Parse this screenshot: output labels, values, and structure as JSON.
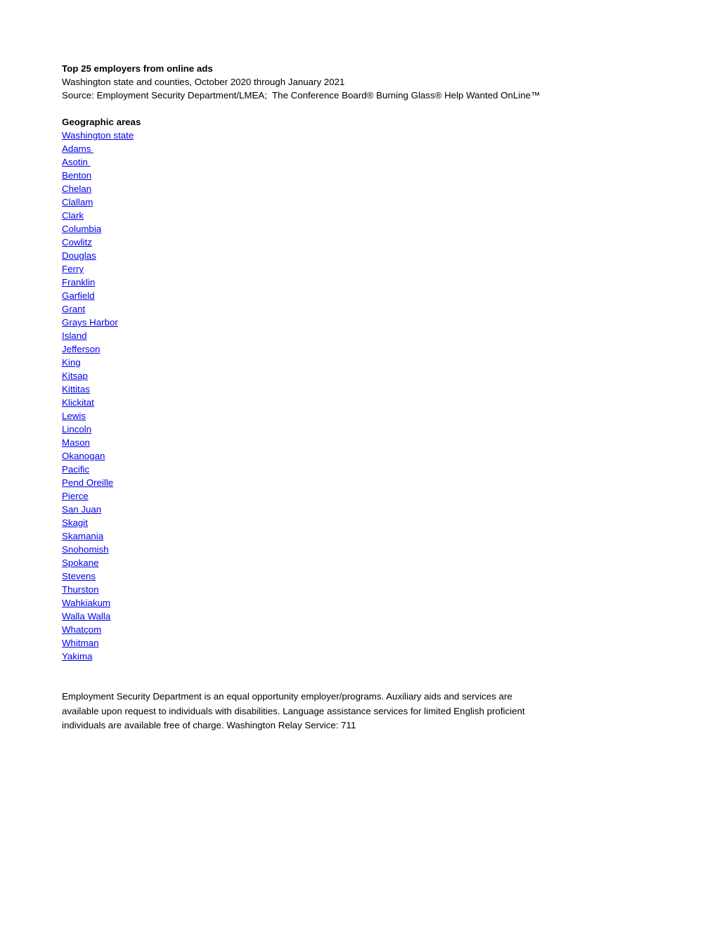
{
  "document": {
    "title": "Top 25 employers from online ads",
    "subtitle": "Washington state and counties, October 2020 through January 2021",
    "source": "Source: Employment Security Department/LMEA;  The Conference Board® Burning Glass® Help Wanted OnLine™"
  },
  "geographic_areas": {
    "heading": "Geographic areas",
    "link_color": "#0000EE",
    "items": [
      {
        "label": "Washington state"
      },
      {
        "label": "Adams "
      },
      {
        "label": "Asotin "
      },
      {
        "label": "Benton"
      },
      {
        "label": "Chelan"
      },
      {
        "label": "Clallam"
      },
      {
        "label": "Clark"
      },
      {
        "label": "Columbia"
      },
      {
        "label": "Cowlitz"
      },
      {
        "label": "Douglas"
      },
      {
        "label": "Ferry"
      },
      {
        "label": "Franklin"
      },
      {
        "label": "Garfield"
      },
      {
        "label": "Grant"
      },
      {
        "label": "Grays Harbor"
      },
      {
        "label": "Island"
      },
      {
        "label": "Jefferson"
      },
      {
        "label": "King"
      },
      {
        "label": "Kitsap"
      },
      {
        "label": "Kittitas"
      },
      {
        "label": "Klickitat"
      },
      {
        "label": "Lewis"
      },
      {
        "label": "Lincoln"
      },
      {
        "label": "Mason"
      },
      {
        "label": "Okanogan"
      },
      {
        "label": "Pacific"
      },
      {
        "label": "Pend Oreille"
      },
      {
        "label": "Pierce"
      },
      {
        "label": "San Juan"
      },
      {
        "label": "Skagit"
      },
      {
        "label": "Skamania"
      },
      {
        "label": "Snohomish"
      },
      {
        "label": "Spokane"
      },
      {
        "label": "Stevens"
      },
      {
        "label": "Thurston"
      },
      {
        "label": "Wahkiakum"
      },
      {
        "label": "Walla Walla"
      },
      {
        "label": "Whatcom"
      },
      {
        "label": "Whitman"
      },
      {
        "label": "Yakima"
      }
    ]
  },
  "footer": {
    "notice": "Employment Security Department is an equal opportunity employer/programs. Auxiliary aids and services are available upon request to individuals with disabilities. Language assistance services for limited English proficient individuals are available free of charge. Washington Relay Service: 711"
  }
}
